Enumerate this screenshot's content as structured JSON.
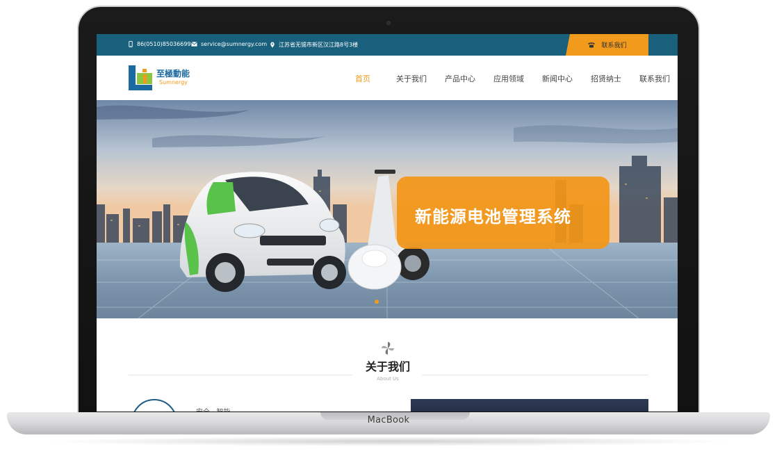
{
  "device": {
    "label": "MacBook"
  },
  "topbar": {
    "phone": "86(0510)85036699",
    "email": "service@sumnergy.com",
    "address": "江苏省无锡市新区汉江路8号3楼",
    "contact_button": "联系我们",
    "bg_color": "#18607c",
    "accent_color": "#f29a1b"
  },
  "logo": {
    "name_cn": "至極動能",
    "name_en": "Sumnergy"
  },
  "nav": {
    "items": [
      {
        "label": "首页",
        "active": true
      },
      {
        "label": "关于我们",
        "active": false
      },
      {
        "label": "产品中心",
        "active": false
      },
      {
        "label": "应用领域",
        "active": false
      },
      {
        "label": "新闻中心",
        "active": false
      },
      {
        "label": "招贤纳士",
        "active": false
      },
      {
        "label": "联系我们",
        "active": false
      }
    ]
  },
  "banner": {
    "title": "新能源电池管理系统",
    "slide_count": 1,
    "current_slide": 1
  },
  "about": {
    "title": "关于我们",
    "subtitle": "About Us",
    "snippet": "安全 · 智能"
  },
  "icons": [
    "phone-icon",
    "mail-icon",
    "location-icon",
    "telephone-icon",
    "pinwheel-icon"
  ]
}
